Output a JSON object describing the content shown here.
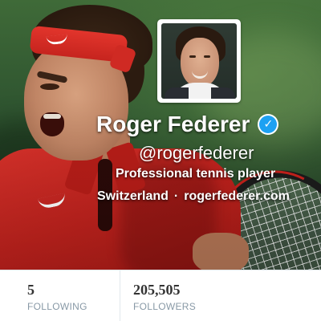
{
  "profile": {
    "name": "Roger Federer",
    "handle": "@rogerfederer",
    "bio": "Professional tennis player",
    "location": "Switzerland",
    "separator": "·",
    "website": "rogerfederer.com",
    "verified": true,
    "verified_icon": "verified-badge-icon",
    "verified_glyph": "✓"
  },
  "stats": {
    "following": {
      "value": "5",
      "label": "FOLLOWING"
    },
    "followers": {
      "value": "205,505",
      "label": "FOLLOWERS"
    }
  },
  "colors": {
    "verified_blue": "#1da1f2",
    "stat_label": "#8899a6",
    "stat_value": "#333333",
    "divider": "#e1e8ed"
  }
}
